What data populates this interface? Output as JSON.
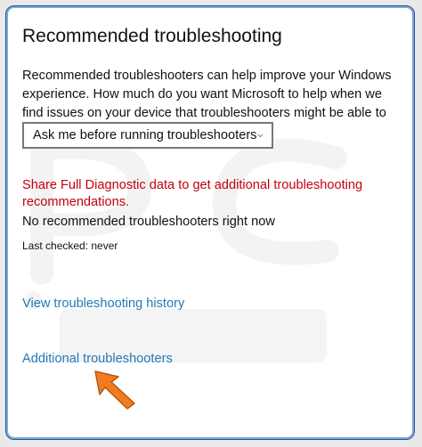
{
  "section": {
    "title": "Recommended troubleshooting",
    "description": "Recommended troubleshooters can help improve your Windows experience. How much do you want Microsoft to help when we find issues on your device that troubleshooters might be able to fix?"
  },
  "dropdown": {
    "selected": "Ask me before running troubleshooters",
    "icon": "chevron-down-icon"
  },
  "diagnostic_link": "Share Full Diagnostic data to get additional troubleshooting recommendations.",
  "status": {
    "message": "No recommended troubleshooters right now",
    "last_checked": "Last checked: never"
  },
  "links": {
    "history": "View troubleshooting history",
    "additional": "Additional troubleshooters"
  },
  "colors": {
    "link": "#1f7ab8",
    "warning_link": "#c5000b",
    "pointer_arrow": "#f07c22"
  }
}
